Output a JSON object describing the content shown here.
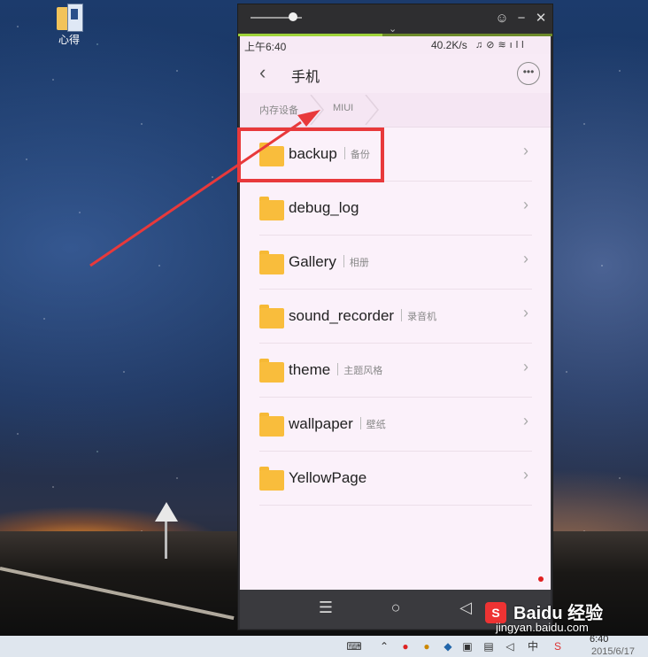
{
  "desktop": {
    "icon_label": "心得"
  },
  "emulator": {
    "controls": {
      "minimize": "−",
      "close": "✕",
      "skin": "☺"
    },
    "progress_fraction": 0.46
  },
  "statusbar": {
    "time": "上午6:40",
    "speed": "40.2K/s",
    "icons": "♫⊘≋ıll"
  },
  "actionbar": {
    "title": "手机",
    "back_icon": "‹",
    "more_icon": "•••"
  },
  "breadcrumb": [
    "内存设备",
    "MIUI"
  ],
  "folders": [
    {
      "name": "backup",
      "desc": "备份"
    },
    {
      "name": "debug_log",
      "desc": ""
    },
    {
      "name": "Gallery",
      "desc": "相册"
    },
    {
      "name": "sound_recorder",
      "desc": "录音机"
    },
    {
      "name": "theme",
      "desc": "主题风格"
    },
    {
      "name": "wallpaper",
      "desc": "壁纸"
    },
    {
      "name": "YellowPage",
      "desc": ""
    }
  ],
  "navbar": {
    "menu": "☰",
    "home": "○",
    "back": "◁"
  },
  "colors": {
    "highlight": "#e8393b",
    "folder": "#f9bd3c",
    "screen_bg": "#fbf1fa"
  },
  "taskbar": {
    "time": "6:40",
    "date": "2015/6/17",
    "ime": "中"
  },
  "watermark": {
    "logo": "S",
    "brand": "Baidu 经验",
    "url": "jingyan.baidu.com"
  }
}
